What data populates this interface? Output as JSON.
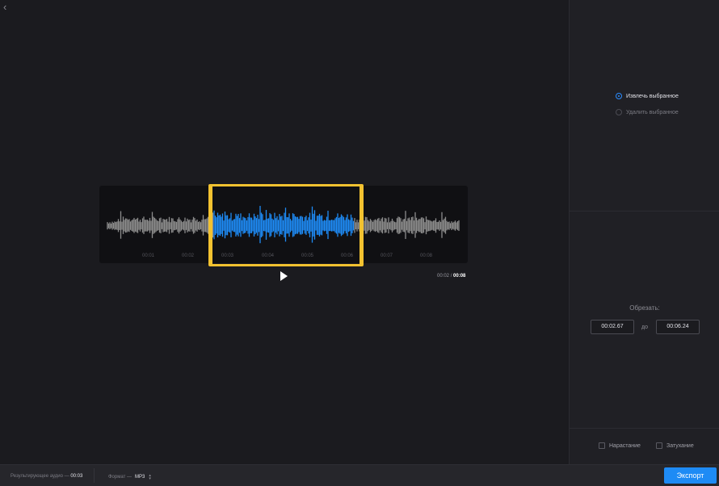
{
  "editor": {
    "ticks": [
      "00:01",
      "00:02",
      "00:03",
      "00:04",
      "00:05",
      "00:06",
      "00:07",
      "00:08"
    ],
    "selection_start_fraction": 0.3,
    "selection_end_fraction": 0.7,
    "current_time": "00:02",
    "time_separator": "/",
    "total_time": "00:08",
    "colors": {
      "selection_wave": "#1e8bf5",
      "wave": "#8c8c8c",
      "selection_border": "#f2c230"
    }
  },
  "sidebar": {
    "mode_options": [
      {
        "label": "Извлечь выбранное",
        "selected": true
      },
      {
        "label": "Удалить выбранное",
        "selected": false
      }
    ],
    "trim_label": "Обрезать:",
    "trim_start": "00:02.67",
    "trim_to": "до",
    "trim_end": "00:06.24",
    "fade_in_label": "Нарастание",
    "fade_out_label": "Затухание"
  },
  "bottom": {
    "result_label": "Результирующее аудио —",
    "result_value": "00:03",
    "format_label": "Формат —",
    "format_value": "MP3",
    "export_label": "Экспорт"
  }
}
